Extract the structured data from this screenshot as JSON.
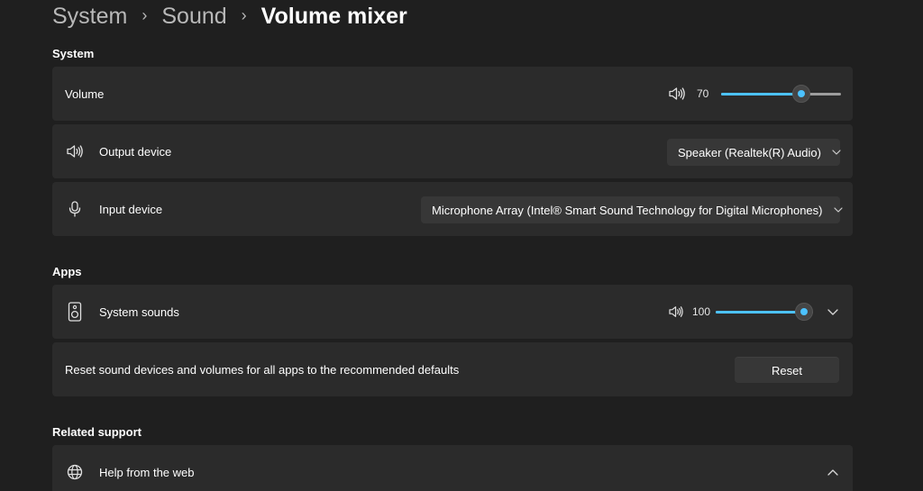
{
  "breadcrumb": {
    "items": [
      "System",
      "Sound",
      "Volume mixer"
    ]
  },
  "system_section": {
    "title": "System",
    "volume": {
      "label": "Volume",
      "value": "70",
      "level": 70,
      "icon": "speaker-icon"
    },
    "output_device": {
      "label": "Output device",
      "icon": "speaker-icon",
      "selected": "Speaker (Realtek(R) Audio)"
    },
    "input_device": {
      "label": "Input device",
      "icon": "microphone-icon",
      "selected": "Microphone Array (Intel® Smart Sound Technology for Digital Microphones)"
    }
  },
  "apps_section": {
    "title": "Apps",
    "system_sounds": {
      "label": "System sounds",
      "icon": "system-sounds-icon",
      "value": "100",
      "level": 100
    },
    "reset": {
      "label": "Reset sound devices and volumes for all apps to the recommended defaults",
      "button_label": "Reset"
    }
  },
  "related_support": {
    "title": "Related support",
    "help_from_web": {
      "label": "Help from the web",
      "icon": "globe-icon"
    }
  },
  "colors": {
    "accent": "#4cc2ff",
    "card_background": "#2b2b2b",
    "page_background": "#1f1f1f"
  }
}
